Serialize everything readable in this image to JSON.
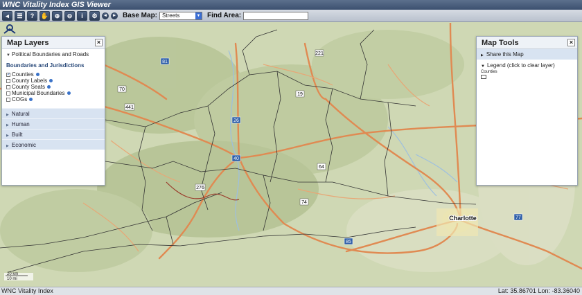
{
  "app": {
    "title": "WNC Vitality Index GIS Viewer"
  },
  "toolbar": {
    "basemap_label": "Base Map:",
    "basemap_value": "Streets",
    "find_label": "Find Area:",
    "find_value": "",
    "icons": [
      "collapse-icon",
      "menu-icon",
      "help-icon",
      "pan-icon",
      "zoom-in-icon",
      "zoom-out-icon",
      "info-icon",
      "gear-icon",
      "back-icon",
      "forward-icon"
    ]
  },
  "layers_panel": {
    "title": "Map Layers",
    "group_label": "Political Boundaries and Roads",
    "section_title": "Boundaries and Jurisdictions",
    "checkboxes": [
      {
        "label": "Counties",
        "checked": true
      },
      {
        "label": "County Labels",
        "checked": false
      },
      {
        "label": "County Seats",
        "checked": false
      },
      {
        "label": "Municipal Boundaries",
        "checked": false
      },
      {
        "label": "COGs",
        "checked": false
      }
    ],
    "categories": [
      "Natural",
      "Human",
      "Built",
      "Economic"
    ]
  },
  "tools_panel": {
    "title": "Map Tools",
    "share_label": "Share this Map",
    "legend_label": "Legend (click to clear layer)",
    "legend_item": "Counties"
  },
  "map": {
    "labels": [
      {
        "text": "Charlotte",
        "kind": "city"
      },
      {
        "text": "221",
        "kind": "route"
      },
      {
        "text": "19",
        "kind": "route"
      },
      {
        "text": "70",
        "kind": "route"
      },
      {
        "text": "40",
        "kind": "route"
      },
      {
        "text": "441",
        "kind": "route"
      },
      {
        "text": "276",
        "kind": "route"
      },
      {
        "text": "64",
        "kind": "route"
      },
      {
        "text": "74",
        "kind": "route"
      },
      {
        "text": "85",
        "kind": "route"
      },
      {
        "text": "26",
        "kind": "route"
      },
      {
        "text": "81",
        "kind": "route"
      },
      {
        "text": "77",
        "kind": "route"
      }
    ],
    "scale": [
      "20 km",
      "10 mi"
    ]
  },
  "status": {
    "left": "WNC Vitality Index",
    "coords": "Lat: 35.86701 Lon: -83.36040"
  },
  "colors": {
    "titlebar": "#3d5170",
    "map_land": "#cfd8b4",
    "highway": "#e08a52",
    "county_line": "#333333"
  }
}
